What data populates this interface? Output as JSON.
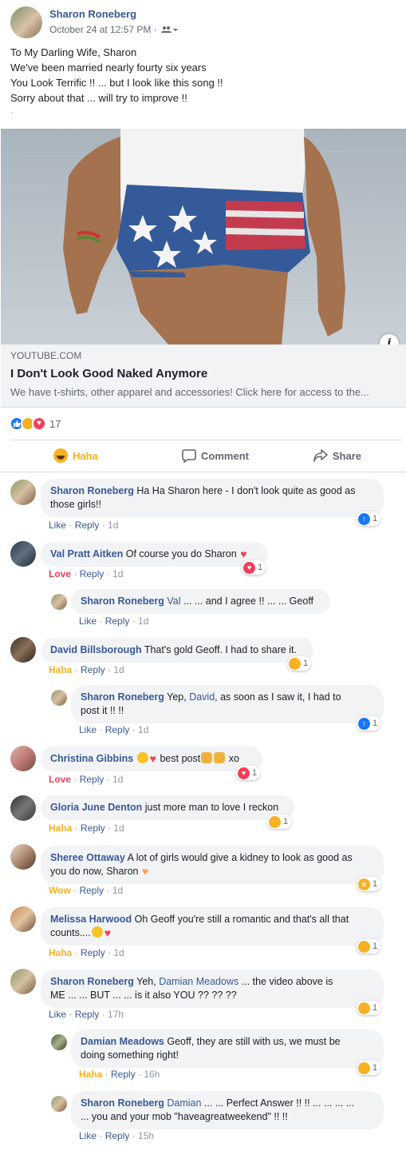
{
  "post": {
    "author": "Sharon Roneberg",
    "timestamp": "October 24 at 12:57 PM ·",
    "audience_icon": "friends-icon",
    "lines": [
      "To My Darling Wife, Sharon",
      "We've been married nearly fourty six years",
      "You Look Terrific !! ... but I look like this song !!",
      "Sorry about that ... will try to improve !!",
      "."
    ]
  },
  "link_card": {
    "domain": "YOUTUBE.COM",
    "title": "I Don't Look Good Naked Anymore",
    "description": "We have t-shirts, other apparel and accessories! Click here for access to the..."
  },
  "reactions": {
    "icons": [
      "like-icon",
      "haha-icon",
      "love-icon"
    ],
    "count": "17"
  },
  "actions": {
    "haha": "Haha",
    "comment": "Comment",
    "share": "Share"
  },
  "colors": {
    "link_blue": "#385898",
    "haha_yellow": "#f7b125",
    "love_red": "#f33e58",
    "like_blue": "#1877f2"
  },
  "comments": [
    {
      "name": "Sharon Roneberg",
      "text1": "Ha Ha Sharon here - I don't look quite as good as",
      "text2": "those girls!!",
      "action": "Like",
      "reply": "Reply",
      "time": "1d",
      "badge_count": "1",
      "badge": "like-icon"
    },
    {
      "name": "Val Pratt Aitken",
      "text1": "Of course you do Sharon",
      "action": "Love",
      "reply": "Reply",
      "time": "1d",
      "badge_count": "1",
      "badge": "love-icon"
    },
    {
      "name": "Sharon Roneberg",
      "mention": "Val",
      "text1": "... ... and I agree !! ... ... Geoff",
      "action": "Like",
      "reply": "Reply",
      "time": "1d"
    },
    {
      "name": "David Billsborough",
      "text1": "That's gold Geoff. I had to share it.",
      "action": "Haha",
      "reply": "Reply",
      "time": "1d",
      "badge_count": "1",
      "badge": "haha-icon"
    },
    {
      "name": "Sharon Roneberg",
      "pre": "Yep,",
      "mention": "David",
      "text1": ", as soon as I saw it, I had to",
      "text2": "post it !! !!",
      "action": "Like",
      "reply": "Reply",
      "time": "1d",
      "badge_count": "1",
      "badge": "like-icon"
    },
    {
      "name": "Christina Gibbins",
      "text1": "best post",
      "text_after": "xo",
      "action": "Love",
      "reply": "Reply",
      "time": "1d",
      "badge_count": "1",
      "badge": "love-icon"
    },
    {
      "name": "Gloria June Denton",
      "text1": "just more man to love I reckon",
      "action": "Haha",
      "reply": "Reply",
      "time": "1d",
      "badge_count": "1",
      "badge": "haha-icon"
    },
    {
      "name": "Sheree Ottaway",
      "text1": "A lot of girls would give a kidney to look as good as",
      "text2": "you do now, Sharon",
      "action": "Wow",
      "reply": "Reply",
      "time": "1d",
      "badge_count": "1",
      "badge": "wow-icon"
    },
    {
      "name": "Melissa Harwood",
      "text1": "Oh Geoff you're still a romantic and that's all that",
      "text2": "counts....",
      "action": "Haha",
      "reply": "Reply",
      "time": "1d",
      "badge_count": "1",
      "badge": "haha-icon"
    },
    {
      "name": "Sharon Roneberg",
      "pre": "Yeh,",
      "mention": "Damian Meadows",
      "text1": "... the video above is",
      "text2": "ME ... ... BUT ... ... is it also YOU ?? ?? ??",
      "action": "Like",
      "reply": "Reply",
      "time": "17h",
      "badge_count": "1",
      "badge": "haha-icon"
    },
    {
      "name": "Damian Meadows",
      "text1": "Geoff, they are still with us, we must be",
      "text2": "doing something right!",
      "action": "Haha",
      "reply": "Reply",
      "time": "16h",
      "badge_count": "1",
      "badge": "haha-icon"
    },
    {
      "name": "Sharon Roneberg",
      "mention": "Damian",
      "text1": "... ... Perfect Answer !! !! ... ... ... ...",
      "text2": "... you and your mob \"haveagreatweekend\" !! !!",
      "action": "Like",
      "reply": "Reply",
      "time": "15h"
    }
  ]
}
